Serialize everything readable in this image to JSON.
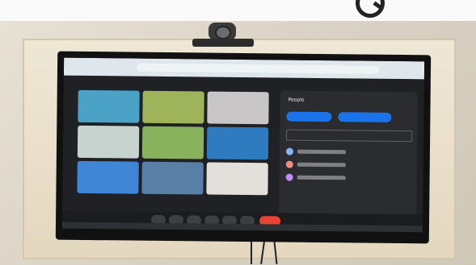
{
  "scene": {
    "panel": {
      "title": "People"
    }
  }
}
